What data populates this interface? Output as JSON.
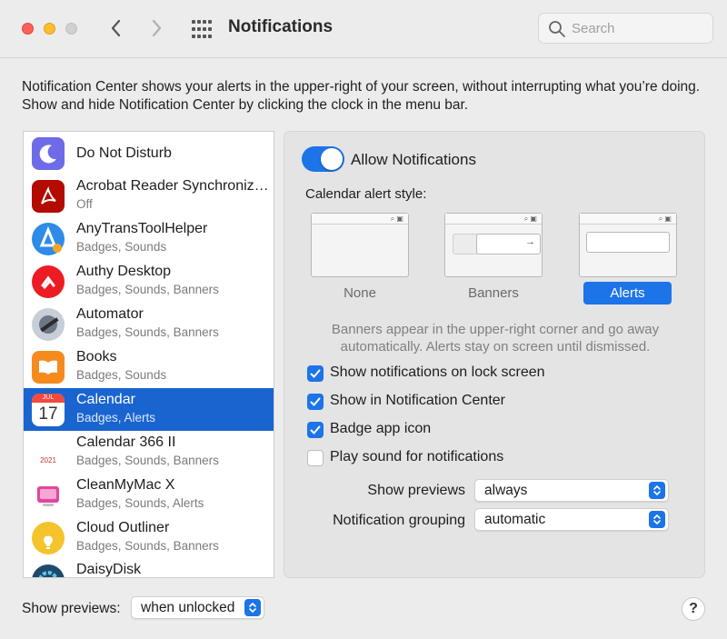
{
  "window": {
    "title": "Notifications",
    "search_placeholder": "Search"
  },
  "description": "Notification Center shows your alerts in the upper-right of your screen, without interrupting what you’re doing. Show and hide Notification Center by clicking the clock in the menu bar.",
  "apps": [
    {
      "name": "Do Not Disturb",
      "sub": "",
      "icon": "moon-icon",
      "color": "#6e6be8"
    },
    {
      "name": "Acrobat Reader Synchroniz…",
      "sub": "Off",
      "icon": "acrobat-icon",
      "color": "#b30b00"
    },
    {
      "name": "AnyTransToolHelper",
      "sub": "Badges, Sounds",
      "icon": "anytrans-icon",
      "color": "#2e8be8"
    },
    {
      "name": "Authy Desktop",
      "sub": "Badges, Sounds, Banners",
      "icon": "authy-icon",
      "color": "#ec1c24"
    },
    {
      "name": "Automator",
      "sub": "Badges, Sounds, Banners",
      "icon": "automator-icon",
      "color": "#8a94a3"
    },
    {
      "name": "Books",
      "sub": "Badges, Sounds",
      "icon": "books-icon",
      "color": "#f58b1f"
    },
    {
      "name": "Calendar",
      "sub": "Badges, Alerts",
      "icon": "calendar-icon",
      "color": "#ffffff",
      "selected": true
    },
    {
      "name": "Calendar 366 II",
      "sub": "Badges, Sounds, Banners",
      "icon": "calendar-366-icon",
      "color": "#ffffff"
    },
    {
      "name": "CleanMyMac X",
      "sub": "Badges, Sounds, Alerts",
      "icon": "cleanmymac-icon",
      "color": "#e0479e"
    },
    {
      "name": "Cloud Outliner",
      "sub": "Badges, Sounds, Banners",
      "icon": "cloud-outliner-icon",
      "color": "#f5c32c"
    },
    {
      "name": "DaisyDisk",
      "sub": "",
      "icon": "daisydisk-icon",
      "color": "#1f4a6b"
    }
  ],
  "calendar_icon": {
    "month": "JUL",
    "day": "17"
  },
  "calendar366_icon": {
    "year": "2021"
  },
  "settings": {
    "allow_label": "Allow Notifications",
    "allow_on": true,
    "style_label": "Calendar alert style:",
    "styles": [
      "None",
      "Banners",
      "Alerts"
    ],
    "selected_style": "Alerts",
    "explain": "Banners appear in the upper-right corner and go away automatically. Alerts stay on screen until dismissed.",
    "checks": [
      {
        "label": "Show notifications on lock screen",
        "checked": true
      },
      {
        "label": "Show in Notification Center",
        "checked": true
      },
      {
        "label": "Badge app icon",
        "checked": true
      },
      {
        "label": "Play sound for notifications",
        "checked": false
      }
    ],
    "previews_label": "Show previews",
    "previews_value": "always",
    "grouping_label": "Notification grouping",
    "grouping_value": "automatic"
  },
  "footer": {
    "previews_label": "Show previews:",
    "previews_value": "when unlocked",
    "help": "?"
  },
  "colors": {
    "accent": "#1c74e8",
    "selected_row": "#1a64d0"
  }
}
